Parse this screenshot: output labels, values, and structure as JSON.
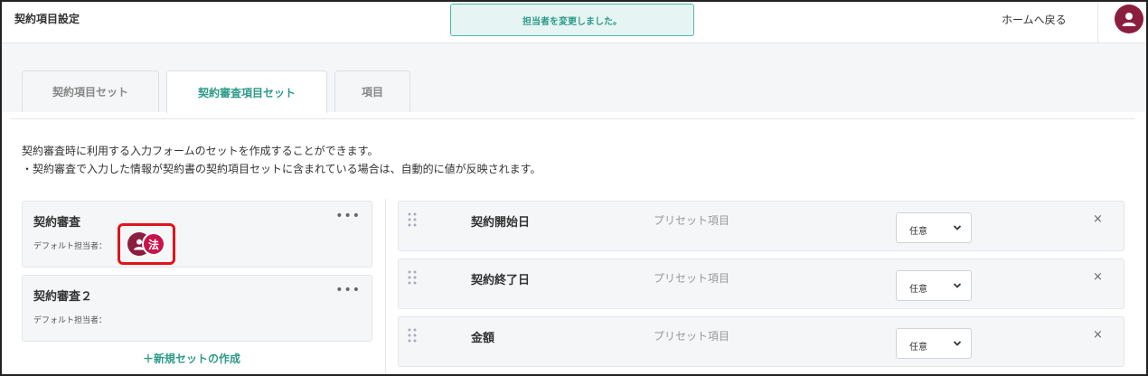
{
  "header": {
    "app_title": "契約項目設定",
    "toast": "担当者を変更しました。",
    "home_link": "ホームへ戻る",
    "avatar_icon": "user-icon",
    "avatar_color": "#8b1e3f"
  },
  "tabs": [
    {
      "label": "契約項目セット",
      "active": false
    },
    {
      "label": "契約審査項目セット",
      "active": true
    },
    {
      "label": "項目",
      "active": false
    }
  ],
  "description": {
    "line1": "契約審査時に利用する入力フォームのセットを作成することができます。",
    "line2": "・契約審査で入力した情報が契約書の契約項目セットに含まれている場合は、自動的に値が反映されます。"
  },
  "sets": [
    {
      "name": "契約審査",
      "menu": "•••",
      "assignee_label": "デフォルト担当者：",
      "badge": "法"
    },
    {
      "name": "契約審査２",
      "menu": "•••",
      "assignee_label": "デフォルト担当者："
    }
  ],
  "new_set": "＋新規セットの作成",
  "items": [
    {
      "name": "契約開始日",
      "type": "プリセット項目",
      "select": "任意",
      "remove": "×"
    },
    {
      "name": "契約終了日",
      "type": "プリセット項目",
      "select": "任意",
      "remove": "×"
    },
    {
      "name": "金額",
      "type": "プリセット項目",
      "select": "任意",
      "remove": "×"
    }
  ],
  "colors": {
    "accent": "#2e9a88",
    "highlight": "#e0141a",
    "legal_badge": "#c7124c"
  }
}
